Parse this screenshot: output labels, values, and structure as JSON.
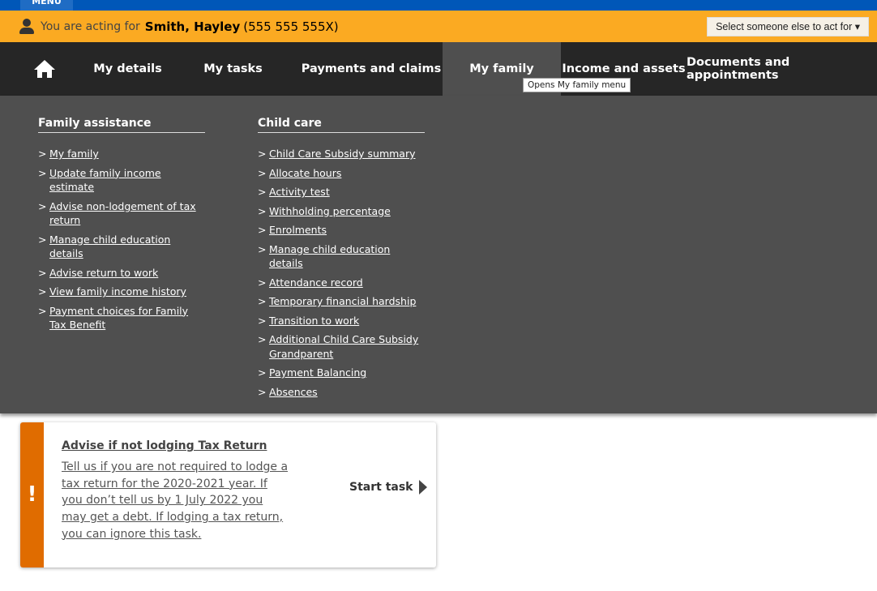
{
  "topbar": {
    "menu_label": "MENU"
  },
  "acting": {
    "prefix": "You are acting for",
    "name": "Smith, Hayley",
    "crn": "(555 555 555X)",
    "select_button": "Select someone else to act for ▾"
  },
  "nav": {
    "items": [
      "My details",
      "My tasks",
      "Payments and claims",
      "My family",
      "Income and assets",
      "Documents and appointments"
    ],
    "active": "My family",
    "tooltip": "Opens My family menu"
  },
  "menu": {
    "family_assistance": {
      "heading": "Family assistance",
      "links": [
        "My family",
        "Update family income estimate",
        "Advise non-lodgement of tax return",
        "Manage child education details",
        "Advise return to work",
        "View family income history",
        "Payment choices for Family Tax Benefit"
      ]
    },
    "child_care": {
      "heading": "Child care",
      "links": [
        "Child Care Subsidy summary",
        "Allocate hours",
        "Activity test",
        "Withholding percentage",
        "Enrolments",
        "Manage child education details",
        "Attendance record",
        "Temporary financial hardship",
        "Transition to work",
        "Additional Child Care Subsidy Grandparent",
        "Payment Balancing",
        "Absences"
      ]
    }
  },
  "task": {
    "icon": "!",
    "title": "Advise if not lodging Tax Return",
    "body": "Tell us if you are not required to lodge a tax return for the 2020-2021 year. If you don’t tell us by 1 July 2022 you may get a debt. If lodging a tax return, you can ignore this task.",
    "start_label": "Start task",
    "accent": "#e06c00"
  }
}
